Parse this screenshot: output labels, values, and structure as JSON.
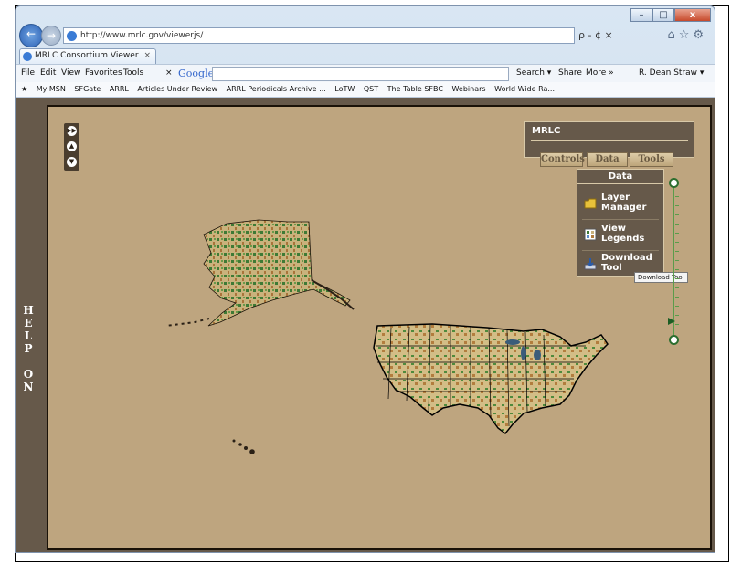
{
  "browser": {
    "url": "http://www.mrlc.gov/viewerjs/",
    "search_label": "ρ - ¢ ×",
    "tab_title": "MRLC Consortium Viewer",
    "tab_close": "×",
    "window_controls": [
      "–",
      "□",
      "x"
    ],
    "menu": [
      "File",
      "Edit",
      "View",
      "Favorites",
      "Tools"
    ],
    "google_label": "Google",
    "toolbar_items": [
      "Search ▾",
      "Share",
      "More »",
      "R. Dean Straw ▾"
    ],
    "favorites": [
      "My MSN",
      "SFGate",
      "ARRL",
      "Articles Under Review",
      "ARRL Periodicals Archive ...",
      "LoTW",
      "QST",
      "The Table SFBC",
      "Webinars",
      "World Wide Ra..."
    ]
  },
  "viewer": {
    "help_letters": [
      "H",
      "E",
      "L",
      "P",
      "",
      "O",
      "N"
    ],
    "panel_title": "MRLC",
    "panel_tabs": [
      "Controls",
      "Data",
      "Tools"
    ],
    "data_header": "Data",
    "data_items": [
      "Layer Manager",
      "View Legends",
      "Download Tool"
    ],
    "tooltip": "Download Tool",
    "colors": {
      "frame": "#66594a",
      "map_bg": "#bea57f",
      "zoom_green": "#2c6e2f"
    }
  }
}
